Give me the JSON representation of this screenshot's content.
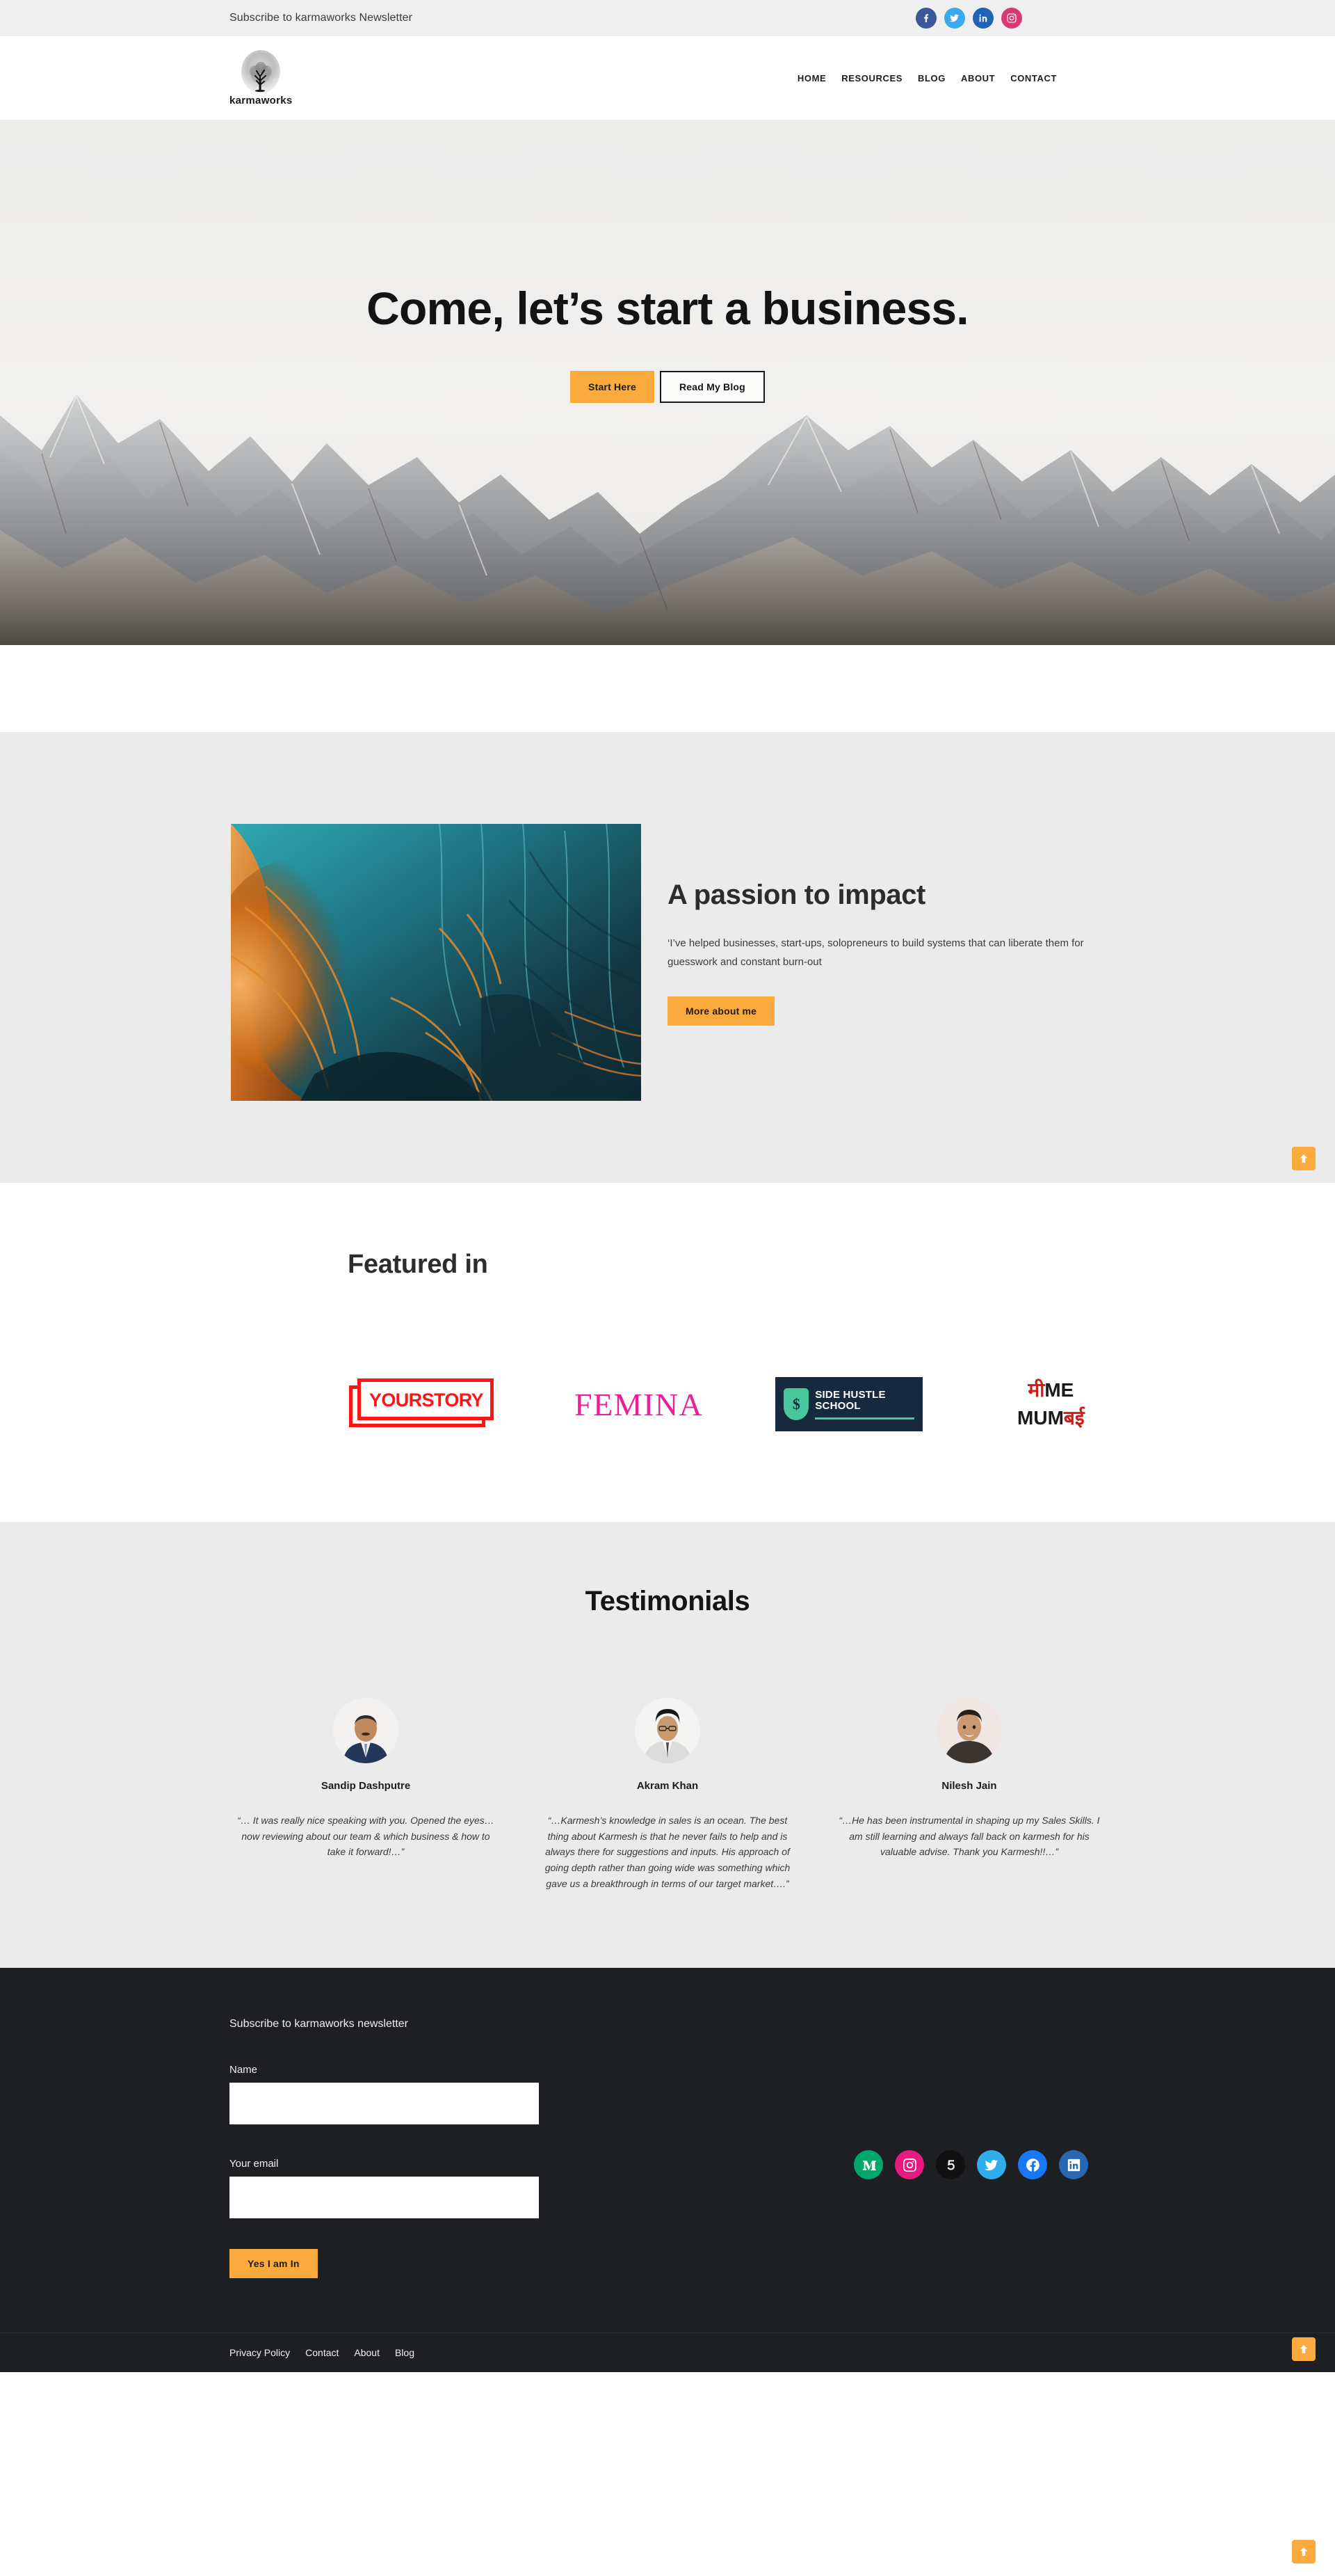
{
  "topbar": {
    "text": "Subscribe to karmaworks Newsletter",
    "social": [
      {
        "name": "facebook-icon",
        "label": "Facebook",
        "color": "#3b5998"
      },
      {
        "name": "twitter-icon",
        "label": "Twitter",
        "color": "#3aa9ee"
      },
      {
        "name": "linkedin-icon",
        "label": "LinkedIn",
        "color": "#1f63b5"
      },
      {
        "name": "instagram-icon",
        "label": "Instagram",
        "color": "#d93a75"
      }
    ]
  },
  "header": {
    "brand_name": "karmaworks",
    "logo_icon": "tree-logo-icon",
    "nav": [
      {
        "label": "HOME"
      },
      {
        "label": "RESOURCES"
      },
      {
        "label": "BLOG"
      },
      {
        "label": "ABOUT"
      },
      {
        "label": "CONTACT"
      }
    ]
  },
  "hero": {
    "title": "Come, let’s start a business.",
    "primary_button": "Start Here",
    "secondary_button": "Read My Blog",
    "background": "snowy-mountain-range-photo"
  },
  "about": {
    "image_alt": "abstract-teal-orange-fluid-art",
    "title": "A passion to impact",
    "text": "‘I’ve helped businesses, start-ups, solopreneurs to build systems that can liberate them for guesswork and constant burn-out",
    "button": "More about me"
  },
  "featured": {
    "title": "Featured in",
    "logos": [
      {
        "name": "yourstory-logo",
        "text": "YOURSTORY"
      },
      {
        "name": "femina-logo",
        "text": "FEMINA"
      },
      {
        "name": "side-hustle-school-logo",
        "text": "SIDE HUSTLE SCHOOL",
        "mark": "$"
      },
      {
        "name": "mime-mumbai-logo",
        "line1_red": "मी",
        "line1_black": "ME",
        "line2_black": "MUM",
        "line2_red": "बई"
      }
    ]
  },
  "testimonials": {
    "title": "Testimonials",
    "items": [
      {
        "name": "Sandip Dashputre",
        "quote": "“… It was really nice speaking with you. Opened the eyes…now reviewing about our team & which business & how to take it forward!…”",
        "avatar": "avatar-sandip"
      },
      {
        "name": "Akram Khan",
        "quote": "“…Karmesh’s knowledge in sales is an ocean. The best thing about Karmesh is that he never fails to help and is always there for suggestions and inputs. His approach of going depth rather than going wide was something which gave us a breakthrough in terms of our target market….”",
        "avatar": "avatar-akram"
      },
      {
        "name": "Nilesh Jain",
        "quote": "“…He has been instrumental in shaping up my Sales Skills. I am still learning and always fall back on karmesh for his valuable advise. Thank you Karmesh!!…”",
        "avatar": "avatar-nilesh"
      }
    ]
  },
  "footer": {
    "newsletter_title": "Subscribe to karmaworks newsletter",
    "name_label": "Name",
    "name_value": "",
    "name_placeholder": "",
    "email_label": "Your email",
    "email_value": "",
    "email_placeholder": "",
    "submit_label": "Yes I am In",
    "social": [
      {
        "name": "medium-icon",
        "label": "Medium",
        "color": "#00a96b"
      },
      {
        "name": "instagram-icon",
        "label": "Instagram",
        "color": "#e8197f"
      },
      {
        "name": "500px-icon",
        "label": "500px",
        "color": "#111111"
      },
      {
        "name": "twitter-icon",
        "label": "Twitter",
        "color": "#2faeee"
      },
      {
        "name": "facebook-icon",
        "label": "Facebook",
        "color": "#1877f2"
      },
      {
        "name": "linkedin-icon",
        "label": "LinkedIn",
        "color": "#2867b2"
      }
    ],
    "links": [
      {
        "label": "Privacy Policy"
      },
      {
        "label": "Contact"
      },
      {
        "label": "About"
      },
      {
        "label": "Blog"
      }
    ]
  },
  "scroll_top": {
    "icon": "arrow-up-icon",
    "color": "#fbab3d"
  },
  "theme": {
    "accent": "#fbab3d",
    "dark": "#1d1f22",
    "light_band": "#ebebeb",
    "topbar_bg": "#efefef"
  }
}
